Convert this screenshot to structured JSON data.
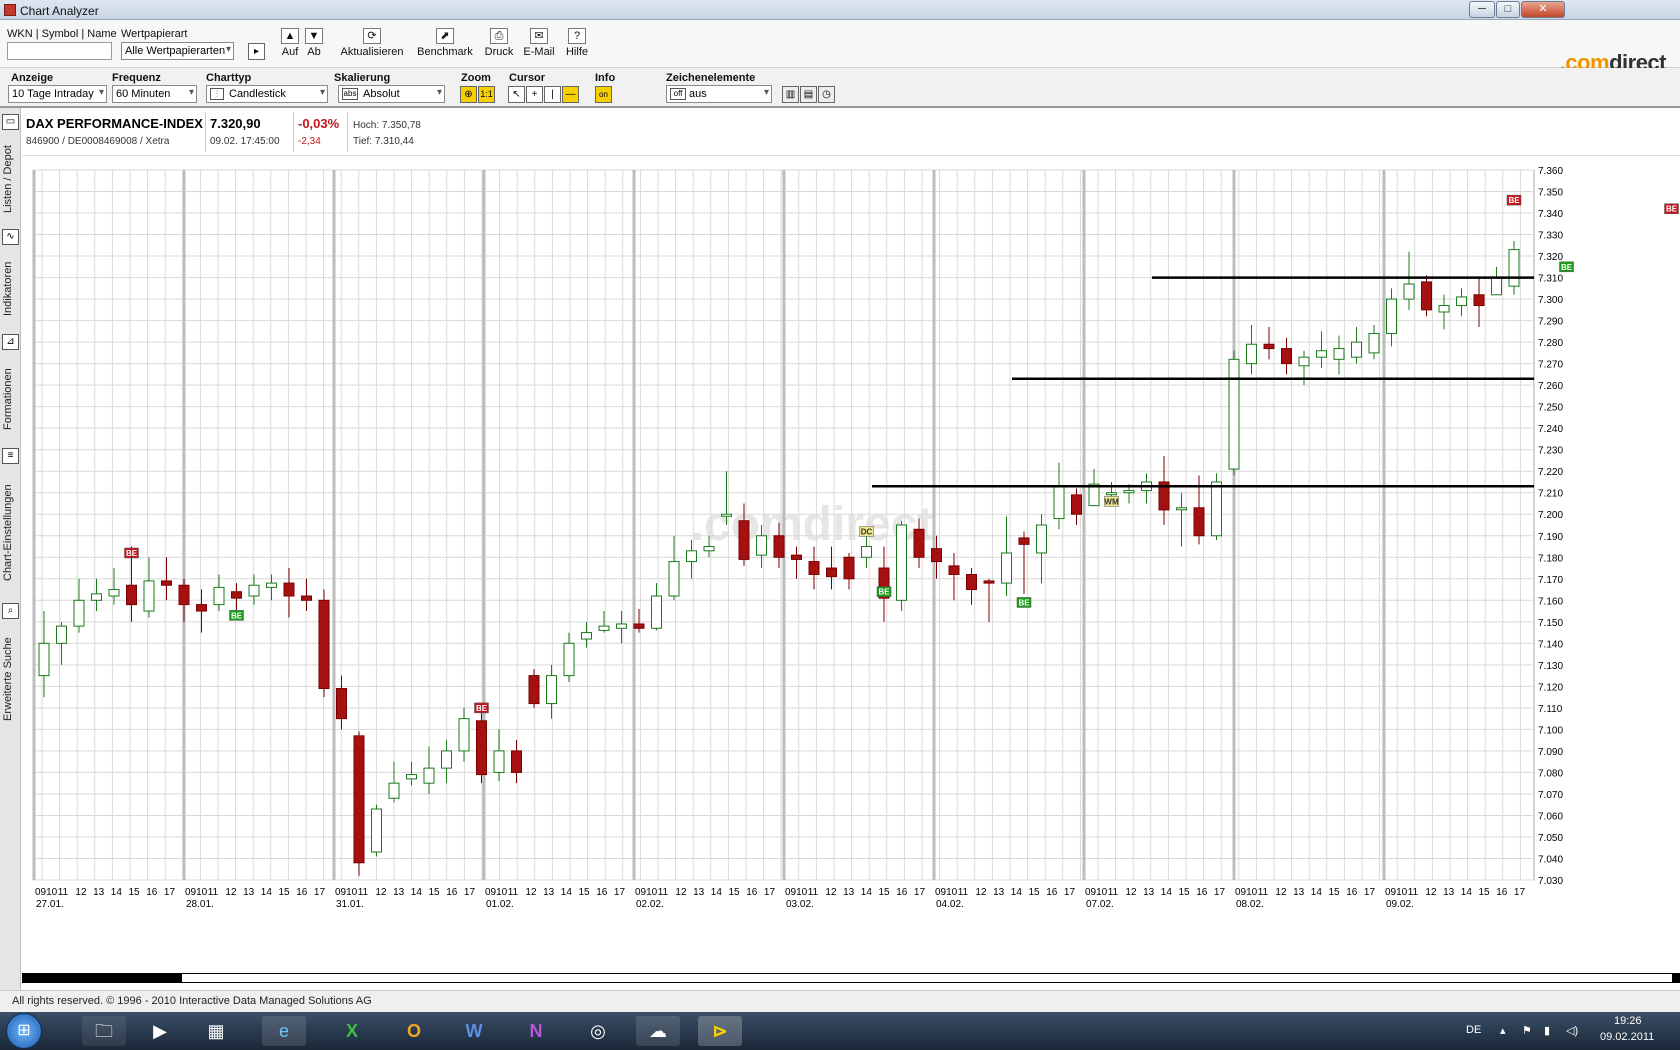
{
  "window": {
    "title": "Chart Analyzer",
    "minimize": "─",
    "maximize": "□",
    "close": "✕"
  },
  "toolbar": {
    "wkn_label": "WKN | Symbol | Name",
    "wkn_value": "",
    "wp_label": "Wertpapierart",
    "wp_value": "Alle Wertpapierarten",
    "go_icon": "play-icon",
    "buttons": [
      {
        "label": "Auf",
        "icon": "▲"
      },
      {
        "label": "Ab",
        "icon": "▼"
      },
      {
        "label": "Aktualisieren",
        "icon": "⟳"
      },
      {
        "label": "Benchmark",
        "icon": "⬈"
      },
      {
        "label": "Druck",
        "icon": "⎙"
      },
      {
        "label": "E-Mail",
        "icon": "✉"
      },
      {
        "label": "Hilfe",
        "icon": "?"
      }
    ],
    "logo_dot": ".",
    "logo_com": "com",
    "logo_direct": "direct"
  },
  "settings": {
    "anzeige_label": "Anzeige",
    "anzeige_value": "10 Tage Intraday",
    "frequenz_label": "Frequenz",
    "frequenz_value": "60 Minuten",
    "charttyp_label": "Charttyp",
    "charttyp_value": "Candlestick",
    "skalierung_label": "Skalierung",
    "skalierung_value": "Absolut",
    "zoom_label": "Zoom",
    "zoom_btn2": "1:1",
    "cursor_label": "Cursor",
    "info_label": "Info",
    "info_value": "on",
    "zeichen_label": "Zeichenelemente",
    "zeichen_value": "aus",
    "zeichen_prefix": "off"
  },
  "sidebar": {
    "tabs": [
      "Listen / Depot",
      "Indikatoren",
      "Formationen",
      "Chart-Einstellungen",
      "Erweiterte Suche"
    ]
  },
  "instrument": {
    "name": "DAX PERFORMANCE-INDEX",
    "ids": "846900 / DE0008469008 / Xetra",
    "price": "7.320,90",
    "time": "09.02. 17:45:00",
    "change_pct": "-0,03%",
    "change_abs": "-2,34",
    "high": "Hoch: 7.350,78",
    "low": "Tief: 7.310,44"
  },
  "chart_data": {
    "type": "candlestick",
    "watermark": ".comdirect",
    "ylim": [
      7030,
      7360
    ],
    "y_ticks": [
      "7.030",
      "7.040",
      "7.050",
      "7.060",
      "7.070",
      "7.080",
      "7.090",
      "7.100",
      "7.110",
      "7.120",
      "7.130",
      "7.140",
      "7.150",
      "7.160",
      "7.170",
      "7.180",
      "7.190",
      "7.200",
      "7.210",
      "7.220",
      "7.230",
      "7.240",
      "7.250",
      "7.260",
      "7.270",
      "7.280",
      "7.290",
      "7.300",
      "7.310",
      "7.320",
      "7.330",
      "7.340",
      "7.350",
      "7.360"
    ],
    "days": [
      "27.01.",
      "28.01.",
      "31.01.",
      "01.02.",
      "02.02.",
      "03.02.",
      "04.02.",
      "07.02.",
      "08.02.",
      "09.02."
    ],
    "hours": [
      "0910",
      "11",
      "12",
      "13",
      "14",
      "15",
      "16",
      "17"
    ],
    "candles": [
      [
        [
          7125,
          7140,
          7115,
          7155
        ],
        [
          7140,
          7148,
          7130,
          7150
        ],
        [
          7148,
          7160,
          7145,
          7170
        ],
        [
          7160,
          7163,
          7155,
          7170
        ],
        [
          7162,
          7165,
          7158,
          7175
        ],
        [
          7167,
          7158,
          7150,
          7185
        ],
        [
          7155,
          7169,
          7152,
          7180
        ],
        [
          7169,
          7167,
          7160,
          7180
        ]
      ],
      [
        [
          7167,
          7158,
          7150,
          7170
        ],
        [
          7158,
          7155,
          7145,
          7165
        ],
        [
          7158,
          7166,
          7155,
          7172
        ],
        [
          7164,
          7161,
          7155,
          7168
        ],
        [
          7162,
          7167,
          7158,
          7172
        ],
        [
          7166,
          7168,
          7160,
          7172
        ],
        [
          7168,
          7162,
          7152,
          7175
        ],
        [
          7162,
          7160,
          7155,
          7170
        ]
      ],
      [
        [
          7160,
          7119,
          7115,
          7165
        ],
        [
          7119,
          7105,
          7100,
          7125
        ],
        [
          7097,
          7038,
          7032,
          7099
        ],
        [
          7043,
          7063,
          7041,
          7065
        ],
        [
          7068,
          7075,
          7066,
          7085
        ],
        [
          7077,
          7079,
          7074,
          7085
        ],
        [
          7075,
          7082,
          7070,
          7092
        ],
        [
          7082,
          7090,
          7075,
          7095
        ]
      ],
      [
        [
          7090,
          7105,
          7085,
          7110
        ],
        [
          7104,
          7079,
          7075,
          7110
        ],
        [
          7080,
          7090,
          7076,
          7100
        ],
        [
          7090,
          7080,
          7075,
          7095
        ],
        [
          7125,
          7112,
          7110,
          7128
        ],
        [
          7112,
          7125,
          7105,
          7130
        ],
        [
          7125,
          7140,
          7122,
          7145
        ],
        [
          7142,
          7145,
          7138,
          7150
        ]
      ],
      [
        [
          7146,
          7148,
          7145,
          7155
        ],
        [
          7147,
          7149,
          7140,
          7155
        ],
        [
          7149,
          7147,
          7145,
          7156
        ],
        [
          7147,
          7162,
          7146,
          7168
        ],
        [
          7162,
          7178,
          7160,
          7190
        ],
        [
          7178,
          7183,
          7170,
          7188
        ],
        [
          7183,
          7185,
          7180,
          7190
        ],
        [
          7200,
          7200,
          7195,
          7220
        ]
      ],
      [
        [
          7197,
          7179,
          7176,
          7205
        ],
        [
          7181,
          7190,
          7175,
          7195
        ],
        [
          7190,
          7180,
          7175,
          7196
        ],
        [
          7181,
          7179,
          7170,
          7185
        ],
        [
          7178,
          7172,
          7165,
          7185
        ],
        [
          7175,
          7171,
          7165,
          7185
        ],
        [
          7180,
          7170,
          7165,
          7182
        ],
        [
          7180,
          7185,
          7175,
          7190
        ]
      ],
      [
        [
          7175,
          7161,
          7150,
          7185
        ],
        [
          7160,
          7195,
          7155,
          7197
        ],
        [
          7193,
          7180,
          7175,
          7198
        ],
        [
          7184,
          7178,
          7170,
          7190
        ],
        [
          7176,
          7172,
          7160,
          7182
        ],
        [
          7172,
          7165,
          7158,
          7175
        ],
        [
          7169,
          7168,
          7150,
          7170
        ],
        [
          7168,
          7182,
          7162,
          7199
        ]
      ],
      [
        [
          7189,
          7186,
          7163,
          7192
        ],
        [
          7182,
          7195,
          7168,
          7200
        ],
        [
          7198,
          7213,
          7193,
          7224
        ],
        [
          7209,
          7200,
          7195,
          7212
        ],
        [
          7204,
          7214,
          7205,
          7221
        ],
        [
          7210,
          7210,
          7208,
          7215
        ],
        [
          7210,
          7211,
          7205,
          7214
        ],
        [
          7211,
          7215,
          7205,
          7219
        ]
      ],
      [
        [
          7215,
          7202,
          7195,
          7227
        ],
        [
          7203,
          7203,
          7185,
          7210
        ],
        [
          7203,
          7190,
          7186,
          7218
        ],
        [
          7190,
          7215,
          7188,
          7219
        ],
        [
          7221,
          7272,
          7218,
          7276
        ],
        [
          7270,
          7279,
          7265,
          7288
        ],
        [
          7279,
          7277,
          7272,
          7287
        ],
        [
          7277,
          7270,
          7265,
          7282
        ]
      ],
      [
        [
          7269,
          7273,
          7260,
          7276
        ],
        [
          7273,
          7276,
          7268,
          7285
        ],
        [
          7272,
          7277,
          7265,
          7283
        ],
        [
          7273,
          7280,
          7270,
          7287
        ],
        [
          7275,
          7284,
          7272,
          7288
        ],
        [
          7284,
          7300,
          7278,
          7305
        ],
        [
          7300,
          7307,
          7295,
          7322
        ],
        [
          7308,
          7295,
          7292,
          7311
        ]
      ],
      [
        [
          7294,
          7297,
          7286,
          7302
        ],
        [
          7297,
          7301,
          7292,
          7305
        ],
        [
          7302,
          7297,
          7287,
          7310
        ],
        [
          7302,
          7310,
          7303,
          7315
        ],
        [
          7306,
          7323,
          7302,
          7327
        ],
        [
          7322,
          7339,
          7318,
          7351
        ],
        [
          7339,
          7340,
          7328,
          7345
        ],
        [
          7339,
          7319,
          7315,
          7350
        ]
      ],
      [
        [
          7318,
          7322,
          7314,
          7325
        ],
        [
          7323,
          7321,
          7318,
          7325
        ],
        [
          7319,
          7323,
          7315,
          7325
        ],
        [
          7322,
          7335,
          7322,
          7342
        ],
        [
          7334,
          7337,
          7325,
          7347
        ],
        [
          7338,
          7320,
          7312,
          7342
        ]
      ]
    ],
    "signals": [
      {
        "label": "BE",
        "type": "sell",
        "day": 0,
        "hour": 5,
        "y": 7182
      },
      {
        "label": "BE",
        "type": "buy",
        "day": 1,
        "hour": 3,
        "y": 7153
      },
      {
        "label": "BE",
        "type": "sell",
        "day": 3,
        "hour": 1,
        "y": 7110
      },
      {
        "label": "DC",
        "type": "neutral",
        "day": 5,
        "hour": 7,
        "y": 7192
      },
      {
        "label": "BE",
        "type": "buy",
        "day": 6,
        "hour": 0,
        "y": 7164
      },
      {
        "label": "BE",
        "type": "buy",
        "day": 6,
        "hour": 8,
        "y": 7159
      },
      {
        "label": "WM",
        "type": "neutral",
        "day": 7,
        "hour": 5,
        "y": 7206
      },
      {
        "label": "BE",
        "type": "sell",
        "day": 10,
        "hour": 4,
        "y": 7346
      },
      {
        "label": "BE",
        "type": "buy",
        "day": 10,
        "hour": 7,
        "y": 7315
      },
      {
        "label": "BE",
        "type": "sell",
        "day": 11,
        "hour": 5,
        "y": 7342
      }
    ],
    "lines": [
      {
        "from_day": 8,
        "from_hour": 0,
        "to_day": 11,
        "to_hour": 6,
        "y": 7310
      },
      {
        "from_day": 7,
        "from_hour": 0,
        "to_day": 11,
        "to_hour": 6,
        "y": 7263
      },
      {
        "from_day": 6,
        "from_hour": 0,
        "to_day": 11,
        "to_hour": 6,
        "y": 7213
      }
    ],
    "colors": {
      "up_fill": "#ffffff",
      "up_stroke": "#1c7a1c",
      "down_fill": "#a51111",
      "down_stroke": "#7a0000",
      "buy": "#1a9a1a",
      "sell": "#c0161c",
      "grid": "#d9d9d9",
      "day_sep": "#bcbcbc"
    }
  },
  "footer": {
    "copyright": "All rights reserved. © 1996 - 2010 Interactive Data Managed Solutions AG"
  },
  "taskbar": {
    "start": "⊞",
    "lang": "DE",
    "time": "19:26",
    "date": "09.02.2011",
    "apps": [
      "🗀",
      "▶",
      "▦",
      "e",
      "X",
      "O",
      "W",
      "N",
      "◎",
      "☁",
      "⊳"
    ]
  }
}
